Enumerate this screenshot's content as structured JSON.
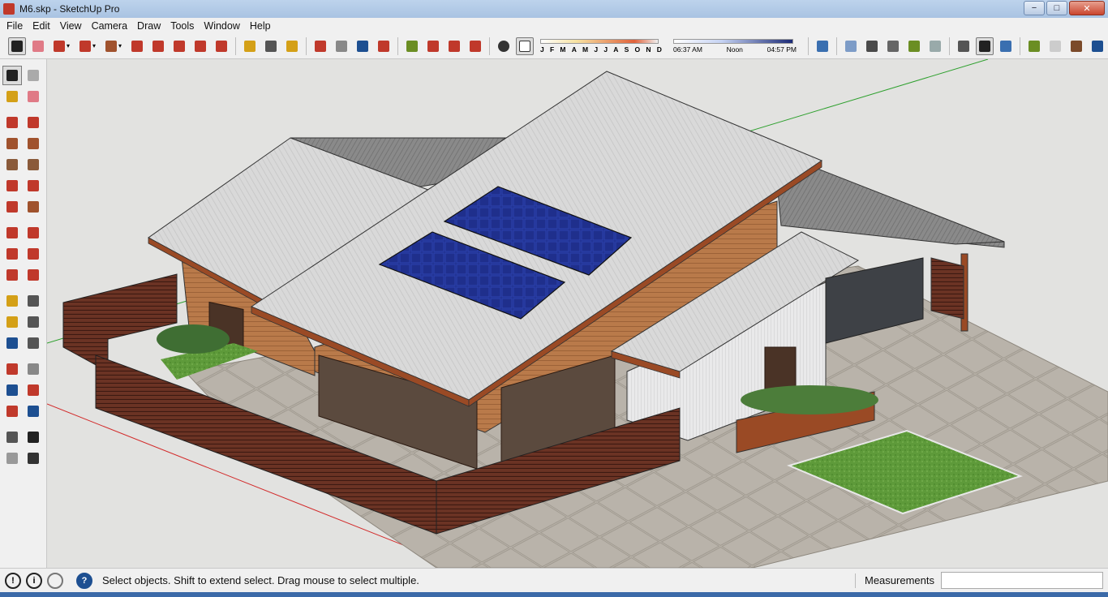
{
  "window": {
    "title": "M6.skp - SketchUp Pro",
    "controls": {
      "minimize": "−",
      "maximize": "□",
      "close": "✕"
    }
  },
  "menu": [
    "File",
    "Edit",
    "View",
    "Camera",
    "Draw",
    "Tools",
    "Window",
    "Help"
  ],
  "toolbar": {
    "tools": [
      {
        "name": "select-tool",
        "icon": "arrow-icon",
        "color": "#222222",
        "active": true
      },
      {
        "name": "eraser-tool",
        "icon": "eraser-icon",
        "color": "#e07a86"
      },
      {
        "name": "line-tool",
        "icon": "pencil-icon",
        "color": "#c0392b",
        "dropdown": true
      },
      {
        "name": "arc-tool",
        "icon": "arc-icon",
        "color": "#c0392b",
        "dropdown": true
      },
      {
        "name": "shape-tool",
        "icon": "rectangle-icon",
        "color": "#a0522d",
        "dropdown": true
      },
      {
        "name": "push-pull-tool",
        "icon": "push-pull-icon",
        "color": "#c0392b"
      },
      {
        "name": "offset-tool",
        "icon": "offset-icon",
        "color": "#c0392b"
      },
      {
        "name": "move-tool",
        "icon": "move-icon",
        "color": "#c0392b"
      },
      {
        "name": "rotate-tool",
        "icon": "rotate-icon",
        "color": "#c0392b"
      },
      {
        "name": "scale-tool",
        "icon": "scale-icon",
        "color": "#c0392b"
      },
      {
        "name": "tape-measure-tool",
        "icon": "tape-icon",
        "color": "#d4a017"
      },
      {
        "name": "text-tool",
        "icon": "text-icon",
        "color": "#555555"
      },
      {
        "name": "paint-bucket-tool",
        "icon": "paint-bucket-icon",
        "color": "#d4a017"
      },
      {
        "name": "orbit-tool",
        "icon": "orbit-icon",
        "color": "#c0392b"
      },
      {
        "name": "pan-tool",
        "icon": "hand-icon",
        "color": "#888888"
      },
      {
        "name": "zoom-tool",
        "icon": "magnifier-icon",
        "color": "#1d4f91"
      },
      {
        "name": "zoom-extents-tool",
        "icon": "zoom-extents-icon",
        "color": "#c0392b"
      },
      {
        "name": "warehouse-tool",
        "icon": "warehouse-icon",
        "color": "#6b8e23"
      },
      {
        "name": "components-tool",
        "icon": "components-icon",
        "color": "#c0392b"
      },
      {
        "name": "extension-tool",
        "icon": "extension-icon",
        "color": "#c0392b"
      },
      {
        "name": "layout-tool",
        "icon": "layout-icon",
        "color": "#c0392b"
      }
    ],
    "shadow_settings": {
      "months": [
        "J",
        "F",
        "M",
        "A",
        "M",
        "J",
        "J",
        "A",
        "S",
        "O",
        "N",
        "D"
      ],
      "time_start": "06:37 AM",
      "time_mid": "Noon",
      "time_end": "04:57 PM"
    },
    "view_tools": [
      {
        "name": "iso-view",
        "icon": "iso-icon"
      },
      {
        "name": "top-view",
        "icon": "top-view-icon"
      },
      {
        "name": "front-view",
        "icon": "front-view-icon"
      },
      {
        "name": "right-view",
        "icon": "right-view-icon"
      },
      {
        "name": "back-view",
        "icon": "back-view-icon"
      },
      {
        "name": "left-view",
        "icon": "left-view-icon"
      },
      {
        "name": "xray-style",
        "icon": "xray-icon"
      },
      {
        "name": "shaded-textures-style",
        "icon": "shaded-textures-icon",
        "active": true
      },
      {
        "name": "monochrome-style",
        "icon": "monochrome-icon"
      },
      {
        "name": "geo-location",
        "icon": "geo-icon"
      },
      {
        "name": "sandbox-tool",
        "icon": "sandbox-icon"
      },
      {
        "name": "walk-tool",
        "icon": "walk-icon"
      },
      {
        "name": "google-earth",
        "icon": "globe-icon"
      }
    ]
  },
  "left_tools": [
    {
      "name": "select",
      "icon": "arrow-icon",
      "active": true
    },
    {
      "name": "make-component",
      "icon": "component-icon"
    },
    {
      "name": "paint-bucket",
      "icon": "paint-bucket-icon"
    },
    {
      "name": "eraser",
      "icon": "eraser-icon"
    },
    {
      "name": "line",
      "icon": "pencil-icon"
    },
    {
      "name": "freehand",
      "icon": "freehand-icon"
    },
    {
      "name": "rectangle",
      "icon": "rectangle-icon"
    },
    {
      "name": "rotated-rectangle",
      "icon": "rotated-rectangle-icon"
    },
    {
      "name": "circle",
      "icon": "circle-icon"
    },
    {
      "name": "polygon",
      "icon": "polygon-icon"
    },
    {
      "name": "arc",
      "icon": "arc-icon"
    },
    {
      "name": "two-point-arc",
      "icon": "two-point-arc-icon"
    },
    {
      "name": "three-point-arc",
      "icon": "three-point-arc-icon"
    },
    {
      "name": "pie",
      "icon": "pie-icon"
    },
    {
      "name": "move",
      "icon": "move-icon"
    },
    {
      "name": "push-pull",
      "icon": "push-pull-icon"
    },
    {
      "name": "rotate",
      "icon": "rotate-icon"
    },
    {
      "name": "follow-me",
      "icon": "follow-me-icon"
    },
    {
      "name": "scale",
      "icon": "scale-icon"
    },
    {
      "name": "offset",
      "icon": "offset-icon"
    },
    {
      "name": "tape-measure",
      "icon": "tape-icon"
    },
    {
      "name": "dimension",
      "icon": "dimension-icon"
    },
    {
      "name": "protractor",
      "icon": "protractor-icon"
    },
    {
      "name": "text",
      "icon": "text-icon"
    },
    {
      "name": "axes",
      "icon": "axes-icon"
    },
    {
      "name": "3d-text",
      "icon": "3d-text-icon"
    },
    {
      "name": "orbit",
      "icon": "orbit-icon"
    },
    {
      "name": "pan",
      "icon": "hand-icon"
    },
    {
      "name": "zoom",
      "icon": "magnifier-icon"
    },
    {
      "name": "zoom-window",
      "icon": "zoom-window-icon"
    },
    {
      "name": "zoom-extents",
      "icon": "zoom-extents-icon"
    },
    {
      "name": "previous-view",
      "icon": "previous-view-icon"
    },
    {
      "name": "position-camera",
      "icon": "position-camera-icon"
    },
    {
      "name": "look-around",
      "icon": "eye-icon"
    },
    {
      "name": "walk",
      "icon": "footprints-icon"
    },
    {
      "name": "section-plane",
      "icon": "section-plane-icon"
    }
  ],
  "status": {
    "message": "Select objects. Shift to extend select. Drag mouse to select multiple.",
    "measurements_label": "Measurements",
    "measurements_value": ""
  },
  "colors": {
    "roof": "#d7d7d7",
    "roof_trim": "#9a4a25",
    "wall_wood": "#b97a4a",
    "fence": "#5a2a1e",
    "solar_panel": "#1d2e8a",
    "paving": "#b8b2a8",
    "lawn": "#5e9a3a",
    "green_axis": "#2ea02e",
    "red_axis": "#d22a2a"
  }
}
